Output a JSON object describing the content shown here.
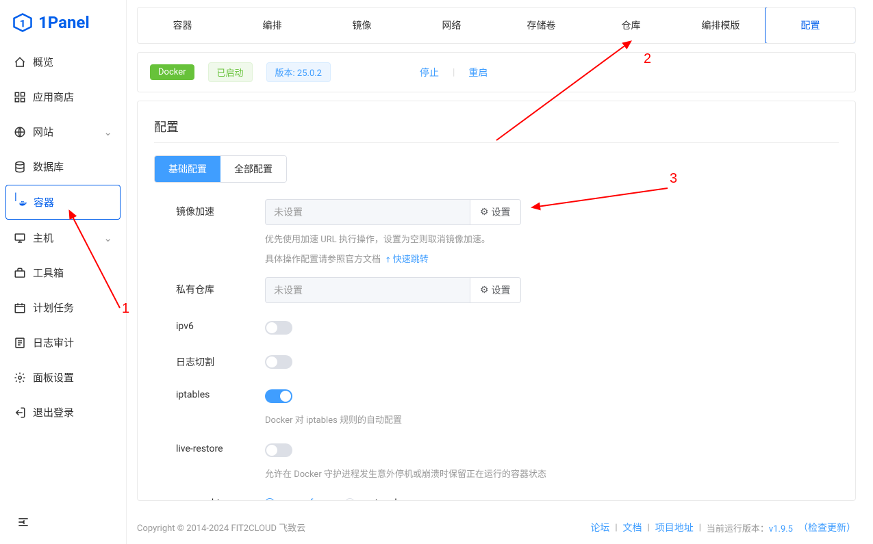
{
  "logo": {
    "text": "1Panel"
  },
  "sidebar": {
    "items": [
      {
        "label": "概览",
        "icon": "home"
      },
      {
        "label": "应用商店",
        "icon": "apps"
      },
      {
        "label": "网站",
        "icon": "globe",
        "expandable": true
      },
      {
        "label": "数据库",
        "icon": "database"
      },
      {
        "label": "容器",
        "icon": "docker",
        "active": true
      },
      {
        "label": "主机",
        "icon": "host",
        "expandable": true
      },
      {
        "label": "工具箱",
        "icon": "toolbox"
      },
      {
        "label": "计划任务",
        "icon": "calendar"
      },
      {
        "label": "日志审计",
        "icon": "log"
      },
      {
        "label": "面板设置",
        "icon": "settings"
      },
      {
        "label": "退出登录",
        "icon": "logout"
      }
    ]
  },
  "tabs": {
    "items": [
      "容器",
      "编排",
      "镜像",
      "网络",
      "存储卷",
      "仓库",
      "编排模版",
      "配置"
    ],
    "active": 7
  },
  "status": {
    "docker": "Docker",
    "running": "已启动",
    "version": "版本: 25.0.2",
    "stop": "停止",
    "restart": "重启"
  },
  "config": {
    "title": "配置",
    "subtabs": {
      "basic": "基础配置",
      "all": "全部配置"
    },
    "mirror": {
      "label": "镜像加速",
      "placeholder": "未设置",
      "button": "设置",
      "help1": "优先使用加速 URL 执行操作，设置为空则取消镜像加速。",
      "help2": "具体操作配置请参照官方文档",
      "help2_link": "快速跳转"
    },
    "repo": {
      "label": "私有仓库",
      "placeholder": "未设置",
      "button": "设置"
    },
    "ipv6": {
      "label": "ipv6"
    },
    "logcut": {
      "label": "日志切割"
    },
    "iptables": {
      "label": "iptables",
      "help": "Docker 对 iptables 规则的自动配置"
    },
    "liverestore": {
      "label": "live-restore",
      "help": "允许在 Docker 守护进程发生意外停机或崩溃时保留正在运行的容器状态"
    },
    "cgroup": {
      "label": "cgroup-driver",
      "opt1": "cgroupfs",
      "opt2": "systemd"
    }
  },
  "footer": {
    "copyright": "Copyright © 2014-2024 FIT2CLOUD 飞致云",
    "forum": "论坛",
    "docs": "文档",
    "project": "项目地址",
    "version_pre": "当前运行版本：",
    "version": "v1.9.5",
    "check": "（检查更新）"
  },
  "annotations": {
    "a1": "1",
    "a2": "2",
    "a3": "3"
  }
}
